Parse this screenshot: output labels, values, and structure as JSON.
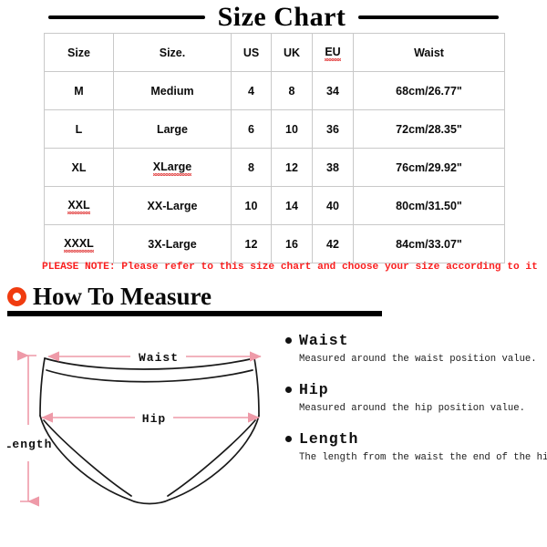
{
  "title": "Size Chart",
  "table": {
    "headers": [
      "Size",
      "Size.",
      "US",
      "UK",
      "EU",
      "Waist"
    ],
    "rows": [
      {
        "size": "M",
        "size_name": "Medium",
        "us": "4",
        "uk": "8",
        "eu": "34",
        "waist": "68cm/26.77\""
      },
      {
        "size": "L",
        "size_name": "Large",
        "us": "6",
        "uk": "10",
        "eu": "36",
        "waist": "72cm/28.35\""
      },
      {
        "size": "XL",
        "size_name": "XLarge",
        "us": "8",
        "uk": "12",
        "eu": "38",
        "waist": "76cm/29.92\""
      },
      {
        "size": "XXL",
        "size_name": "XX-Large",
        "us": "10",
        "uk": "14",
        "eu": "40",
        "waist": "80cm/31.50\""
      },
      {
        "size": "XXXL",
        "size_name": "3X-Large",
        "us": "12",
        "uk": "16",
        "eu": "42",
        "waist": "84cm/33.07\""
      }
    ]
  },
  "note": "PLEASE NOTE: Please refer to this size chart and choose your size according to it",
  "how_to_measure": {
    "heading": "How To Measure",
    "bullet_color": "#f03c10",
    "items": [
      {
        "label": "Waist",
        "description": "Measured around the waist position value."
      },
      {
        "label": "Hip",
        "description": "Measured around the hip position value."
      },
      {
        "label": "Length",
        "description": "The length from the waist the end of the hip."
      }
    ]
  },
  "diagram": {
    "arrow_color": "#ee9aa8",
    "outline_color": "#1a1a1a",
    "labels": {
      "waist": "Waist",
      "hip": "Hip",
      "length": "Length"
    }
  },
  "colors": {
    "note_red": "#fa2020",
    "table_border": "#c9c9c9",
    "spellcheck_red": "#e23b3b"
  }
}
